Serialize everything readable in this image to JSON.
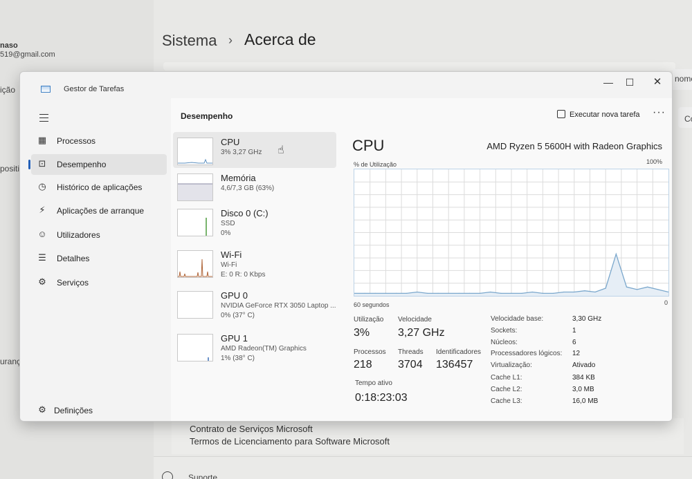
{
  "background": {
    "user_name": "naso",
    "user_email": "519@gmail.com",
    "left_fragment_1": "ição",
    "left_fragment_2": "positivo",
    "left_fragment_3": "uranç",
    "breadcrumb_parent": "Sistema",
    "breadcrumb_sep": "›",
    "breadcrumb_current": "Acerca de",
    "right_fragment_1": "nome",
    "right_fragment_2": "Co",
    "links": [
      "Contrato de Serviços Microsoft",
      "Termos de Licenciamento para Software Microsoft"
    ],
    "partial_bottom": "Suporte"
  },
  "window": {
    "title": "Gestor de Tarefas",
    "minimize": "—",
    "maximize": "☐",
    "close": "✕"
  },
  "nav": {
    "items": [
      {
        "label": "Processos",
        "icon": "processes-icon"
      },
      {
        "label": "Desempenho",
        "icon": "performance-icon"
      },
      {
        "label": "Histórico de aplicações",
        "icon": "history-icon"
      },
      {
        "label": "Aplicações de arranque",
        "icon": "startup-icon"
      },
      {
        "label": "Utilizadores",
        "icon": "users-icon"
      },
      {
        "label": "Detalhes",
        "icon": "details-icon"
      },
      {
        "label": "Serviços",
        "icon": "services-icon"
      }
    ],
    "settings_label": "Definições"
  },
  "toolbar": {
    "page_title": "Desempenho",
    "run_task_label": "Executar nova tarefa",
    "more_label": "···"
  },
  "resources": [
    {
      "name": "CPU",
      "line1": "3% 3,27 GHz",
      "line2": ""
    },
    {
      "name": "Memória",
      "line1": "4,6/7,3 GB (63%)",
      "line2": ""
    },
    {
      "name": "Disco 0 (C:)",
      "line1": "SSD",
      "line2": "0%"
    },
    {
      "name": "Wi-Fi",
      "line1": "Wi-Fi",
      "line2": "E: 0 R: 0 Kbps"
    },
    {
      "name": "GPU 0",
      "line1": "NVIDIA GeForce RTX 3050 Laptop ...",
      "line2": "0% (37° C)"
    },
    {
      "name": "GPU 1",
      "line1": "AMD Radeon(TM) Graphics",
      "line2": "1% (38° C)"
    }
  ],
  "cpu_detail": {
    "title": "CPU",
    "model": "AMD Ryzen 5 5600H with Radeon Graphics",
    "util_label": "% de Utilização",
    "max_label": "100%",
    "time_label": "60 segundos",
    "min_label": "0",
    "stats": {
      "utilization_label": "Utilização",
      "utilization_value": "3%",
      "speed_label": "Velocidade",
      "speed_value": "3,27 GHz",
      "processes_label": "Processos",
      "processes_value": "218",
      "threads_label": "Threads",
      "threads_value": "3704",
      "handles_label": "Identificadores",
      "handles_value": "136457",
      "uptime_label": "Tempo ativo",
      "uptime_value": "0:18:23:03"
    },
    "specs": [
      {
        "k": "Velocidade base:",
        "v": "3,30 GHz"
      },
      {
        "k": "Sockets:",
        "v": "1"
      },
      {
        "k": "Núcleos:",
        "v": "6"
      },
      {
        "k": "Processadores lógicos:",
        "v": "12"
      },
      {
        "k": "Virtualização:",
        "v": "Ativado"
      },
      {
        "k": "Cache L1:",
        "v": "384 KB"
      },
      {
        "k": "Cache L2:",
        "v": "3,0 MB"
      },
      {
        "k": "Cache L3:",
        "v": "16,0 MB"
      }
    ]
  },
  "chart_data": {
    "type": "area",
    "title": "CPU",
    "xlabel": "60 segundos",
    "ylabel": "% de Utilização",
    "ylim": [
      0,
      100
    ],
    "x": [
      60,
      58,
      56,
      54,
      52,
      50,
      48,
      46,
      44,
      42,
      40,
      38,
      36,
      34,
      32,
      30,
      28,
      26,
      24,
      22,
      20,
      18,
      16,
      14,
      12,
      10,
      8,
      6,
      4,
      2,
      0
    ],
    "series": [
      {
        "values": [
          2,
          2,
          2,
          2,
          2,
          2,
          3,
          2,
          2,
          2,
          2,
          2,
          2,
          3,
          2,
          2,
          2,
          3,
          2,
          2,
          3,
          3,
          4,
          3,
          6,
          33,
          7,
          5,
          7,
          5,
          3
        ]
      }
    ],
    "grid": true,
    "color": "#7aa7cc"
  }
}
